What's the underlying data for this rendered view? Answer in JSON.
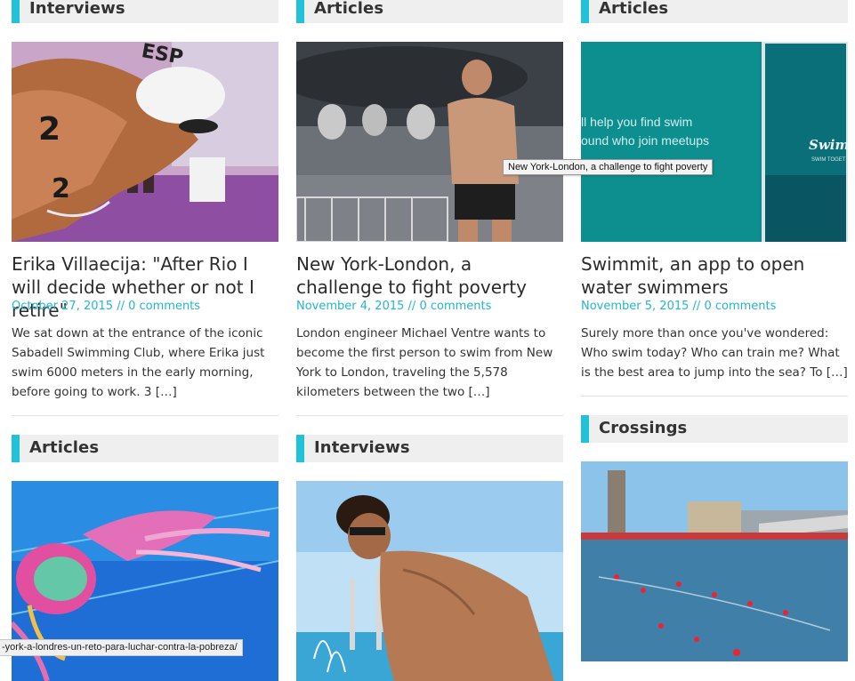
{
  "posts": [
    {
      "category": "Interviews",
      "title": "Erika Villaecija: \"After Rio I will decide whether or not I retire\"",
      "date": "October 27, 2015",
      "separator": "//",
      "comments": "0 comments",
      "excerpt": "We sat down at the entrance of the iconic Sabadell Swimming Club, where Erika just swim 6000 meters in the early morning, before going to work. 3 […]",
      "image_icon": "swimmer-photo-icon"
    },
    {
      "category": "Articles",
      "title": "New York-London, a challenge to fight poverty",
      "date": "November 4, 2015",
      "separator": "//",
      "comments": "0 comments",
      "excerpt": "London engineer Michael Ventre wants to become the first person to swim from New York to London, traveling the 5,578 kilometers between the two […]",
      "image_icon": "thames-barrier-photo-icon"
    },
    {
      "category": "Articles",
      "title": "Swimmit, an app to open water swimmers",
      "date": "November 5, 2015",
      "separator": "//",
      "comments": "0 comments",
      "excerpt": "Surely more than once you've wondered: Who swim today? Who can train me? What is the best area to jump into the sea? To […]",
      "image_icon": "app-screenshot-icon",
      "image_text_1": "ll help you find swim",
      "image_text_2": "ound who join meetups",
      "image_logo": "Swimm",
      "image_logo_sub": "SWIM TOGET"
    },
    {
      "category": "Articles",
      "image_icon": "jellyfish-photo-icon"
    },
    {
      "category": "Interviews",
      "image_icon": "pool-swimmer-photo-icon"
    },
    {
      "category": "Crossings",
      "image_icon": "harbour-crossing-photo-icon"
    }
  ],
  "tooltip": "New York-London, a challenge to fight poverty",
  "status_url": "-york-a-londres-un-reto-para-luchar-contra-la-pobreza/",
  "colors": {
    "accent": "#1fc2d8",
    "link": "#25b5ce",
    "category_bg": "#efefef"
  }
}
